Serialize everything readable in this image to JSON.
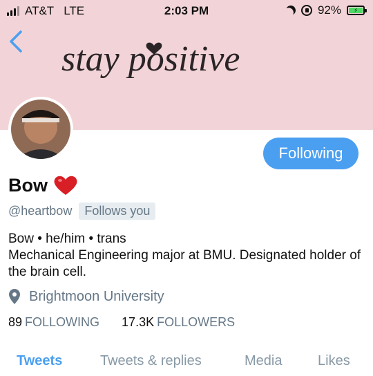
{
  "status_bar": {
    "carrier": "AT&T",
    "network": "LTE",
    "time": "2:03 PM",
    "battery_percent": "92%",
    "battery_level": 0.92,
    "icons": [
      "signal-icon",
      "moon-icon",
      "rotation-lock-icon",
      "battery-charging-icon"
    ]
  },
  "header": {
    "banner_text": "stay positive",
    "banner_color": "#f2d4d8",
    "back_icon": "chevron-left-icon"
  },
  "profile": {
    "name": "Bow",
    "handle": "@heartbow",
    "follows_you_label": "Follows you",
    "follow_button_label": "Following",
    "bio_line1": "Bow • he/him • trans",
    "bio_line2": "Mechanical Engineering major at BMU. Designated holder of the brain cell.",
    "location": "Brightmoon University",
    "following_count": "89",
    "following_label": "FOLLOWING",
    "followers_count": "17.3K",
    "followers_label": "FOLLOWERS"
  },
  "tabs": [
    {
      "label": "Tweets",
      "active": true
    },
    {
      "label": "Tweets & replies",
      "active": false
    },
    {
      "label": "Media",
      "active": false
    },
    {
      "label": "Likes",
      "active": false
    }
  ],
  "colors": {
    "accent": "#4a9ff0",
    "muted": "#657786"
  }
}
